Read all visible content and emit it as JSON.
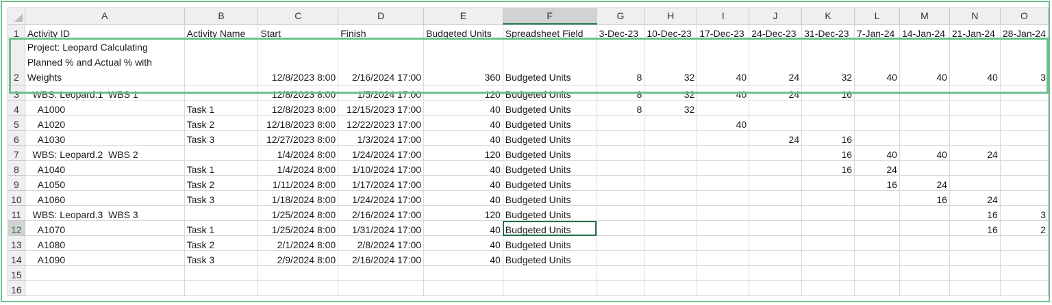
{
  "columns": [
    "A",
    "B",
    "C",
    "D",
    "E",
    "F",
    "G",
    "H",
    "I",
    "J",
    "K",
    "L",
    "M",
    "N",
    "O"
  ],
  "selected_cell": "F12",
  "accent_color": "#217346",
  "highlight_color": "#6cc08a",
  "rows": [
    [
      "Activity ID",
      "Activity Name",
      "Start",
      "Finish",
      "Budgeted Units",
      "Spreadsheet Field",
      "3-Dec-23",
      "10-Dec-23",
      "17-Dec-23",
      "24-Dec-23",
      "31-Dec-23",
      "7-Jan-24",
      "14-Jan-24",
      "21-Jan-24",
      "28-Jan-24"
    ],
    [
      "Project: Leopard  Calculating Planned % and Actual % with Weights",
      "",
      "12/8/2023 8:00",
      "2/16/2024 17:00",
      "360",
      "Budgeted Units",
      "8",
      "32",
      "40",
      "24",
      "32",
      "40",
      "40",
      "40",
      "3"
    ],
    [
      "  WBS: Leopard.1  WBS 1",
      "",
      "12/8/2023 8:00",
      "1/5/2024 17:00",
      "120",
      "Budgeted Units",
      "8",
      "32",
      "40",
      "24",
      "16",
      "",
      "",
      "",
      ""
    ],
    [
      "    A1000",
      "Task 1",
      "12/8/2023 8:00",
      "12/15/2023 17:00",
      "40",
      "Budgeted Units",
      "8",
      "32",
      "",
      "",
      "",
      "",
      "",
      "",
      ""
    ],
    [
      "    A1020",
      "Task 2",
      "12/18/2023 8:00",
      "12/22/2023 17:00",
      "40",
      "Budgeted Units",
      "",
      "",
      "40",
      "",
      "",
      "",
      "",
      "",
      ""
    ],
    [
      "    A1030",
      "Task 3",
      "12/27/2023 8:00",
      "1/3/2024 17:00",
      "40",
      "Budgeted Units",
      "",
      "",
      "",
      "24",
      "16",
      "",
      "",
      "",
      ""
    ],
    [
      "  WBS: Leopard.2  WBS 2",
      "",
      "1/4/2024 8:00",
      "1/24/2024 17:00",
      "120",
      "Budgeted Units",
      "",
      "",
      "",
      "",
      "16",
      "40",
      "40",
      "24",
      ""
    ],
    [
      "    A1040",
      "Task 1",
      "1/4/2024 8:00",
      "1/10/2024 17:00",
      "40",
      "Budgeted Units",
      "",
      "",
      "",
      "",
      "16",
      "24",
      "",
      "",
      ""
    ],
    [
      "    A1050",
      "Task 2",
      "1/11/2024 8:00",
      "1/17/2024 17:00",
      "40",
      "Budgeted Units",
      "",
      "",
      "",
      "",
      "",
      "16",
      "24",
      "",
      ""
    ],
    [
      "    A1060",
      "Task 3",
      "1/18/2024 8:00",
      "1/24/2024 17:00",
      "40",
      "Budgeted Units",
      "",
      "",
      "",
      "",
      "",
      "",
      "16",
      "24",
      ""
    ],
    [
      "  WBS: Leopard.3  WBS 3",
      "",
      "1/25/2024 8:00",
      "2/16/2024 17:00",
      "120",
      "Budgeted Units",
      "",
      "",
      "",
      "",
      "",
      "",
      "",
      "16",
      "3"
    ],
    [
      "    A1070",
      "Task 1",
      "1/25/2024 8:00",
      "1/31/2024 17:00",
      "40",
      "Budgeted Units",
      "",
      "",
      "",
      "",
      "",
      "",
      "",
      "16",
      "2"
    ],
    [
      "    A1080",
      "Task 2",
      "2/1/2024 8:00",
      "2/8/2024 17:00",
      "40",
      "Budgeted Units",
      "",
      "",
      "",
      "",
      "",
      "",
      "",
      "",
      ""
    ],
    [
      "    A1090",
      "Task 3",
      "2/9/2024 8:00",
      "2/16/2024 17:00",
      "40",
      "Budgeted Units",
      "",
      "",
      "",
      "",
      "",
      "",
      "",
      "",
      ""
    ],
    [
      "",
      "",
      "",
      "",
      "",
      "",
      "",
      "",
      "",
      "",
      "",
      "",
      "",
      "",
      ""
    ],
    [
      "",
      "",
      "",
      "",
      "",
      "",
      "",
      "",
      "",
      "",
      "",
      "",
      "",
      "",
      ""
    ]
  ],
  "row_numbers": [
    "1",
    "2",
    "3",
    "4",
    "5",
    "6",
    "7",
    "8",
    "9",
    "10",
    "11",
    "12",
    "13",
    "14",
    "15",
    "16"
  ]
}
